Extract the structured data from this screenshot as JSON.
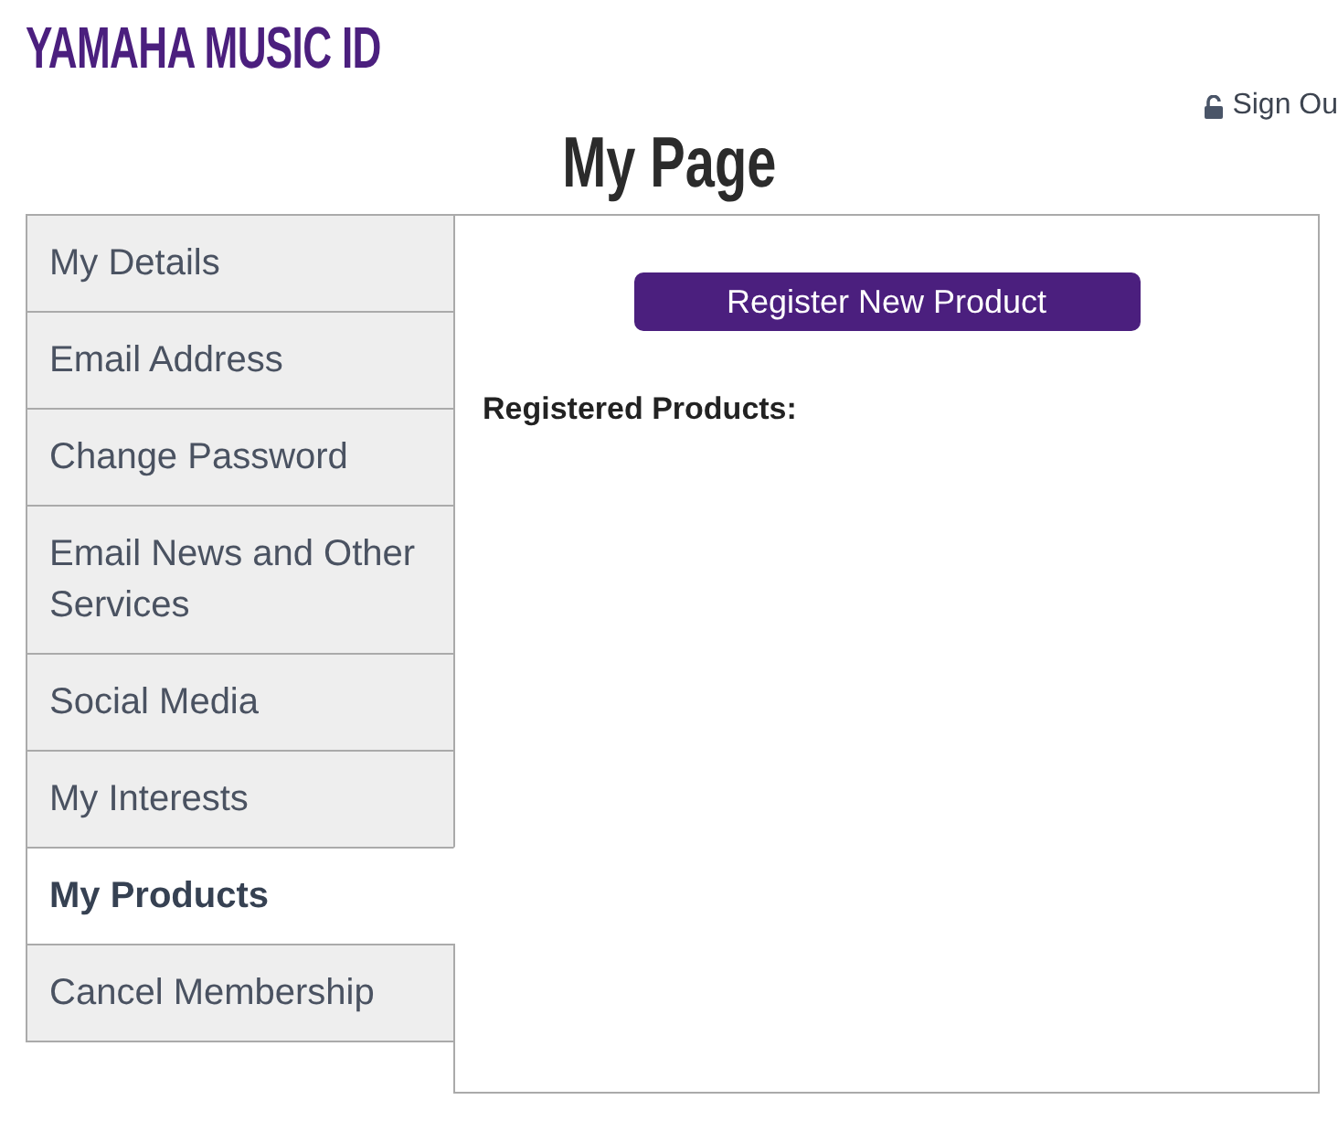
{
  "header": {
    "logo": "YAMAHA MUSIC ID",
    "sign_out": "Sign Ou"
  },
  "title": "My Page",
  "sidebar": {
    "items": [
      {
        "label": "My Details",
        "selected": false
      },
      {
        "label": "Email Address",
        "selected": false
      },
      {
        "label": "Change Password",
        "selected": false
      },
      {
        "label": "Email News and Other Services",
        "selected": false
      },
      {
        "label": "Social Media",
        "selected": false
      },
      {
        "label": "My Interests",
        "selected": false
      },
      {
        "label": "My Products",
        "selected": true
      },
      {
        "label": "Cancel Membership",
        "selected": false
      }
    ]
  },
  "content": {
    "button": "Register New Product",
    "heading": "Registered Products:"
  }
}
